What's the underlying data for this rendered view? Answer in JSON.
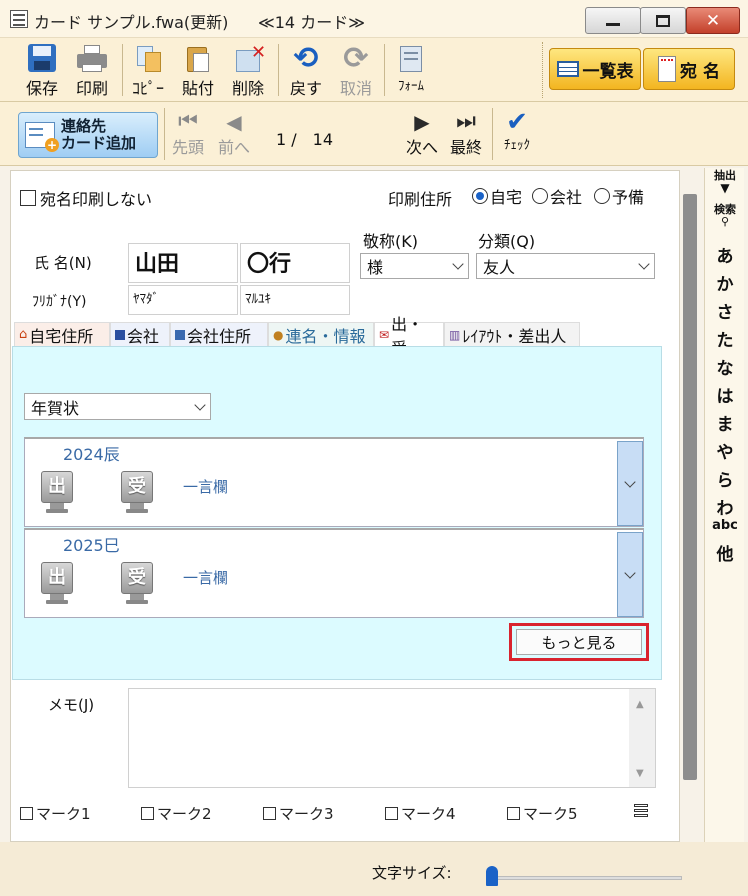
{
  "window": {
    "title": "カード サンプル.fwa(更新)",
    "subtitle": "≪14 カード≫"
  },
  "toolbar": {
    "save": "保存",
    "print": "印刷",
    "copy": "ｺﾋﾟｰ",
    "paste": "貼付",
    "delete": "削除",
    "undo": "戻す",
    "redo": "取消",
    "form": "ﾌｫｰﾑ",
    "list": "一覧表",
    "address": "宛 名"
  },
  "nav": {
    "add_line1": "連絡先",
    "add_line2": "カード追加",
    "first": "先頭",
    "prev": "前へ",
    "position": "1 /　14",
    "next": "次へ",
    "last": "最終",
    "check": "ﾁｪｯｸ"
  },
  "form": {
    "no_print_label": "宛名印刷しない",
    "print_address_label": "印刷住所",
    "address_options": [
      "自宅",
      "会社",
      "予備"
    ],
    "selected_address": "自宅",
    "name_label": "氏 名(N)",
    "last_name": "山田",
    "first_name": "〇行",
    "furigana_label": "ﾌﾘｶﾞﾅ(Y)",
    "furigana_last": "ﾔﾏﾀﾞ",
    "furigana_first": "ﾏﾙﾕｷ",
    "honorific_label": "敬称(K)",
    "honorific_value": "様",
    "category_label": "分類(Q)",
    "category_value": "友人"
  },
  "tabs": [
    "自宅住所",
    "会社",
    "会社住所",
    "連名・情報",
    "出・受",
    "ﾚｲｱｳﾄ・差出人"
  ],
  "active_tab": "出・受",
  "greeting": {
    "type_value": "年賀状",
    "records": [
      {
        "year": "2024辰",
        "sent": "出",
        "received": "受",
        "note": "一言欄"
      },
      {
        "year": "2025巳",
        "sent": "出",
        "received": "受",
        "note": "一言欄"
      }
    ],
    "more_button": "もっと見る"
  },
  "memo_label": "メモ(J)",
  "marks": [
    "マーク1",
    "マーク2",
    "マーク3",
    "マーク4",
    "マーク5"
  ],
  "font_size_label": "文字サイズ:",
  "font_size_level": 0.0,
  "side_index": {
    "extract_label": "抽出",
    "search_label": "検索",
    "items": [
      "あ",
      "か",
      "さ",
      "た",
      "な",
      "は",
      "ま",
      "や",
      "ら",
      "わ",
      "abc",
      "他"
    ]
  }
}
